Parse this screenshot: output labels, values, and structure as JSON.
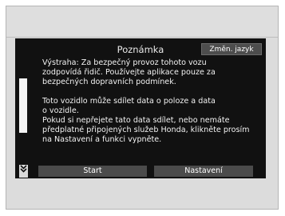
{
  "dialog": {
    "title": "Poznámka",
    "lang_button": "Změn. jazyk",
    "warning_line1": "Výstraha: Za bezpečný provoz tohoto vozu",
    "warning_line2": "zodpovídá řidič. Používejte aplikace pouze za",
    "warning_line3": "bezpečných dopravních podmínek.",
    "data_line1": "Toto vozidlo může sdílet data o poloze a data",
    "data_line2": "o vozidle.",
    "data_line3": "Pokud si nepřejete tato data sdílet, nebo nemáte",
    "data_line4": "předplatné připojených služeb Honda, klikněte prosím",
    "data_line5": "na Nastavení a funkci vypněte.",
    "start_button": "Start",
    "settings_button": "Nastavení"
  },
  "scroll": {
    "down_icon": "double-chevron-down-icon"
  }
}
